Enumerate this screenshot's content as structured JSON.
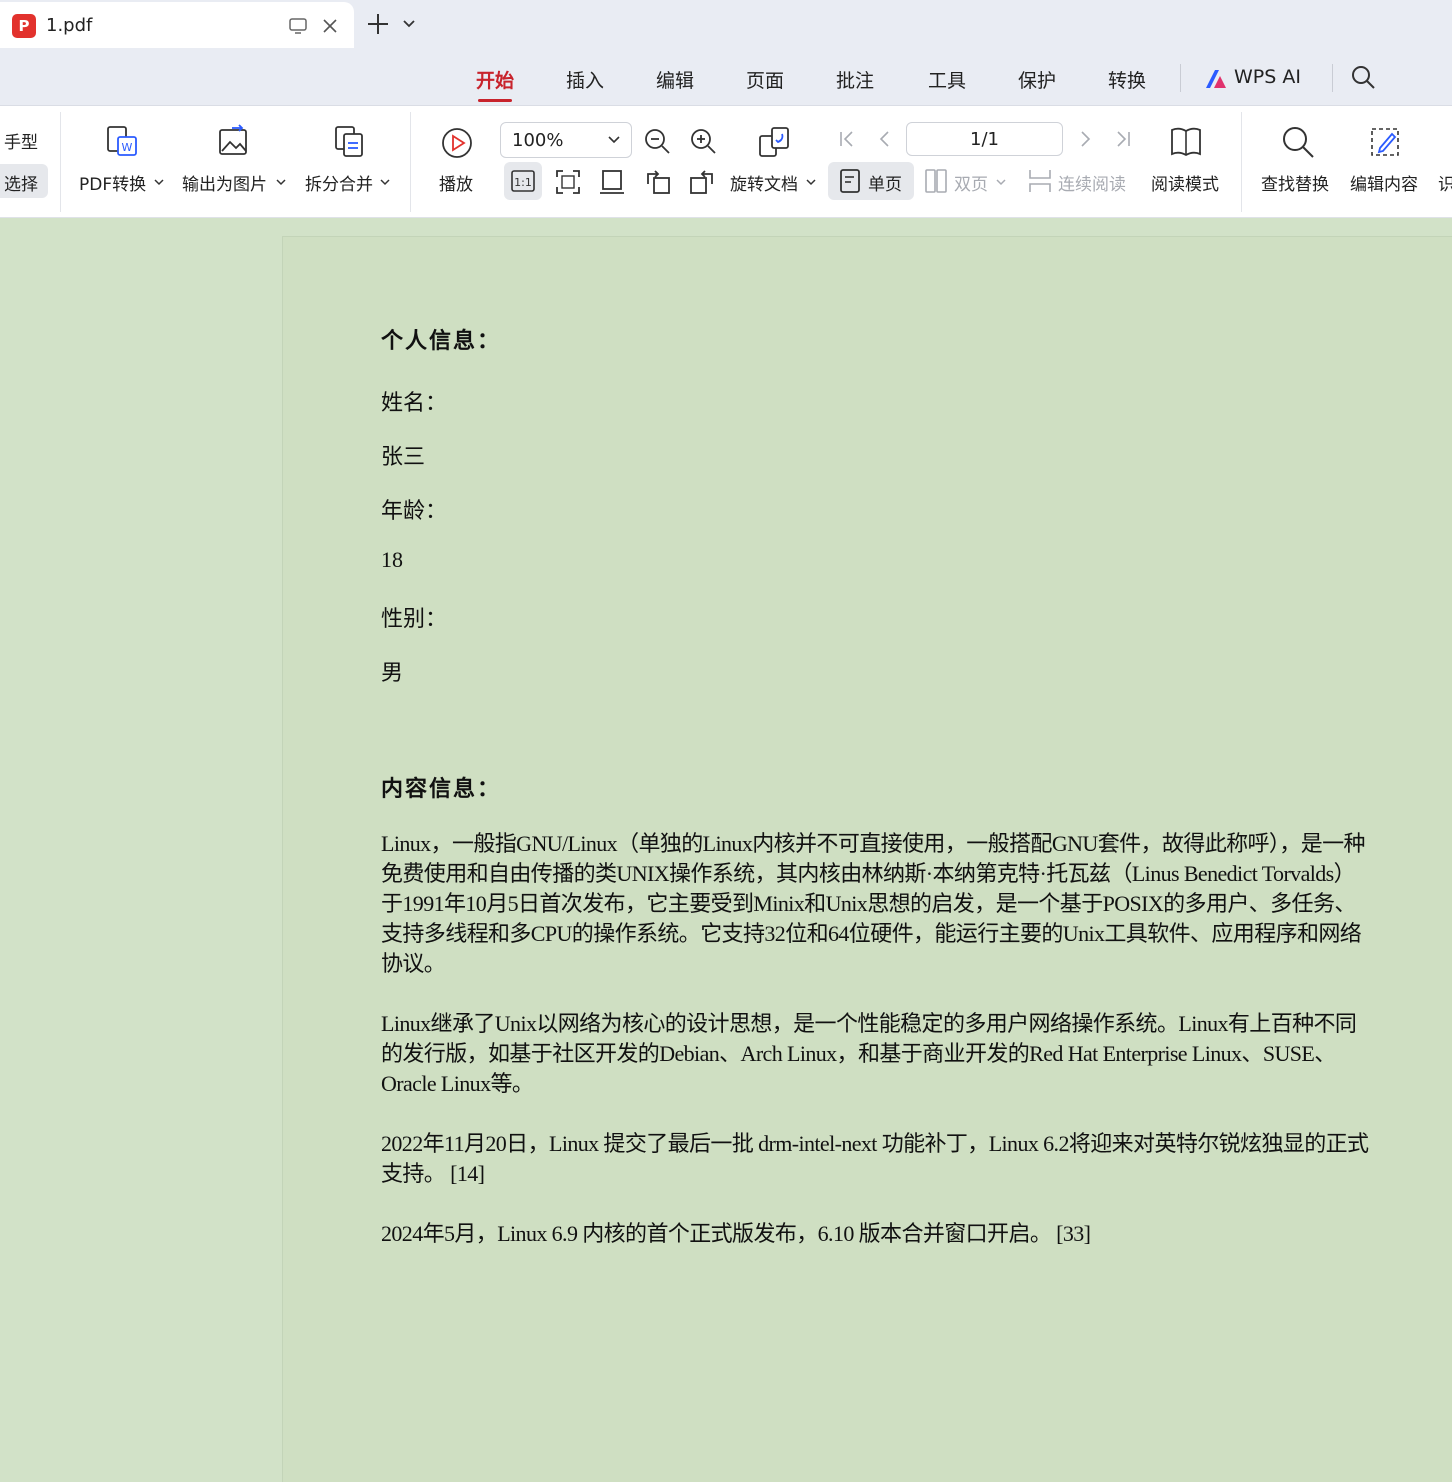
{
  "tab": {
    "title": "1.pdf",
    "pdf_icon_glyph": "P"
  },
  "menu": {
    "items": [
      "开始",
      "插入",
      "编辑",
      "页面",
      "批注",
      "工具",
      "保护",
      "转换"
    ],
    "active_index": 0,
    "wps_ai": "WPS AI",
    "accent_color": "#c8232c"
  },
  "toolbar": {
    "hand": "手型",
    "select": "选择",
    "pdf_convert": "PDF转换",
    "export_image": "输出为图片",
    "split_merge": "拆分合并",
    "play": "播放",
    "zoom": "100%",
    "one_to_one": "1:1",
    "rotate_doc": "旋转文档",
    "single_page": "单页",
    "double_page": "双页",
    "continuous": "连续阅读",
    "page_indicator": "1/1",
    "reading_mode": "阅读模式",
    "find_replace": "查找替换",
    "edit_content": "编辑内容",
    "cut_char": "识"
  },
  "document": {
    "section1_title": "个人信息：",
    "fields": {
      "name_label": "姓名：",
      "name_value": "张三",
      "age_label": "年龄：",
      "age_value": "18",
      "gender_label": "性别：",
      "gender_value": "男"
    },
    "section2_title": "内容信息：",
    "paragraphs": [
      "Linux，一般指GNU/Linux（单独的Linux内核并不可直接使用，一般搭配GNU套件，故得此称呼），是一种免费使用和自由传播的类UNIX操作系统，其内核由林纳斯·本纳第克特·托瓦兹（Linus Benedict Torvalds）于1991年10月5日首次发布，它主要受到Minix和Unix思想的启发，是一个基于POSIX的多用户、多任务、支持多线程和多CPU的操作系统。它支持32位和64位硬件，能运行主要的Unix工具软件、应用程序和网络协议。",
      "Linux继承了Unix以网络为核心的设计思想，是一个性能稳定的多用户网络操作系统。Linux有上百种不同的发行版，如基于社区开发的Debian、Arch Linux，和基于商业开发的Red Hat Enterprise Linux、SUSE、Oracle Linux等。",
      "2022年11月20日，Linux 提交了最后一批 drm-intel-next 功能补丁，Linux 6.2将迎来对英特尔锐炫独显的正式支持。 [14]",
      "2024年5月，Linux 6.9 内核的首个正式版发布，6.10 版本合并窗口开启。 [33]"
    ]
  }
}
